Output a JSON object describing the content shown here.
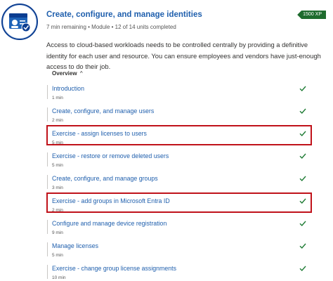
{
  "module": {
    "title": "Create, configure, and manage identities",
    "meta": "7 min remaining • Module • 12 of 14 units completed",
    "xp": "1500 XP",
    "description": "Access to cloud-based workloads needs to be controlled centrally by providing a definitive identity for each user and resource. You can ensure employees and vendors have just-enough access to do their job.",
    "overview_label": "Overview",
    "overview_chevron": "^"
  },
  "units": [
    {
      "name": "Introduction",
      "duration": "1 min",
      "completed": true,
      "highlighted": false
    },
    {
      "name": "Create, configure, and manage users",
      "duration": "2 min",
      "completed": true,
      "highlighted": false
    },
    {
      "name": "Exercise - assign licenses to users",
      "duration": "5 min",
      "completed": true,
      "highlighted": true
    },
    {
      "name": "Exercise - restore or remove deleted users",
      "duration": "5 min",
      "completed": true,
      "highlighted": false
    },
    {
      "name": "Create, configure, and manage groups",
      "duration": "3 min",
      "completed": true,
      "highlighted": false
    },
    {
      "name": "Exercise - add groups in Microsoft Entra ID",
      "duration": "2 min",
      "completed": true,
      "highlighted": true
    },
    {
      "name": "Configure and manage device registration",
      "duration": "9 min",
      "completed": true,
      "highlighted": false
    },
    {
      "name": "Manage licenses",
      "duration": "5 min",
      "completed": true,
      "highlighted": false
    },
    {
      "name": "Exercise - change group license assignments",
      "duration": "10 min",
      "completed": true,
      "highlighted": false
    }
  ],
  "colors": {
    "link": "#1f5fad",
    "check": "#1e7b34",
    "highlight_border": "#c0121a",
    "xp_badge": "#1e6b2e"
  },
  "icons": {
    "module_badge": "identity-badge-icon",
    "completed": "checkmark-icon"
  }
}
